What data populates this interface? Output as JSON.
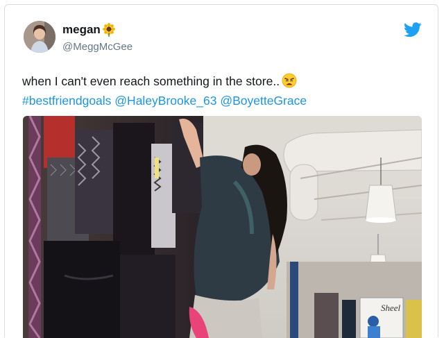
{
  "tweet": {
    "display_name": "megan",
    "name_emoji": "sunflower-icon",
    "handle": "@MeggMcGee",
    "text": "when I can't even reach something in the store..",
    "text_emoji": "weary-face-icon",
    "hashtag": "#bestfriendgoals",
    "mention_1": "@HaleyBrooke_63",
    "mention_2": "@BoyetteGrace",
    "logo": "twitter-bird-icon",
    "photo_sign_text": "Sheel"
  },
  "colors": {
    "link": "#1b95e0",
    "text": "#14171a",
    "secondary_text": "#657786",
    "twitter_blue": "#1da1f2"
  }
}
